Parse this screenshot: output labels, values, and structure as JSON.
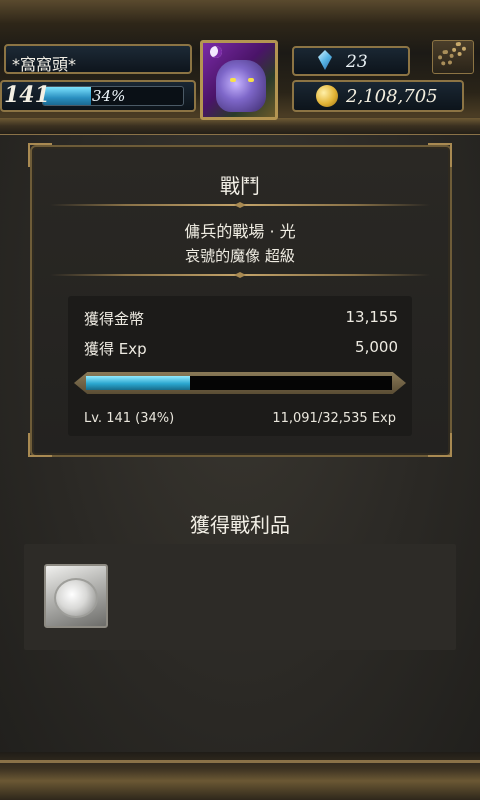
{
  "hud": {
    "player_name": "*窩窩頭*",
    "level": "141",
    "level_percent_label": "34%",
    "level_progress_fraction": 0.34,
    "gems": "23",
    "gold": "2,108,705"
  },
  "battle": {
    "title": "戰鬥",
    "stage_name": "傭兵的戰場 · 光",
    "stage_sub": "哀號的魔像 超級",
    "rows": [
      {
        "label": "獲得金幣",
        "value": "13,155"
      },
      {
        "label": "獲得 Exp",
        "value": "5,000"
      }
    ],
    "exp_progress_fraction": 0.34,
    "level_line": "Lv. 141 (34%)",
    "exp_line": "11,091/32,535 Exp"
  },
  "loot": {
    "title": "獲得戰利品",
    "items": [
      {
        "icon": "silver-coin-card-icon"
      }
    ]
  },
  "colors": {
    "accent_gold": "#a98a52",
    "bar_blue": "#2aa6cf"
  }
}
